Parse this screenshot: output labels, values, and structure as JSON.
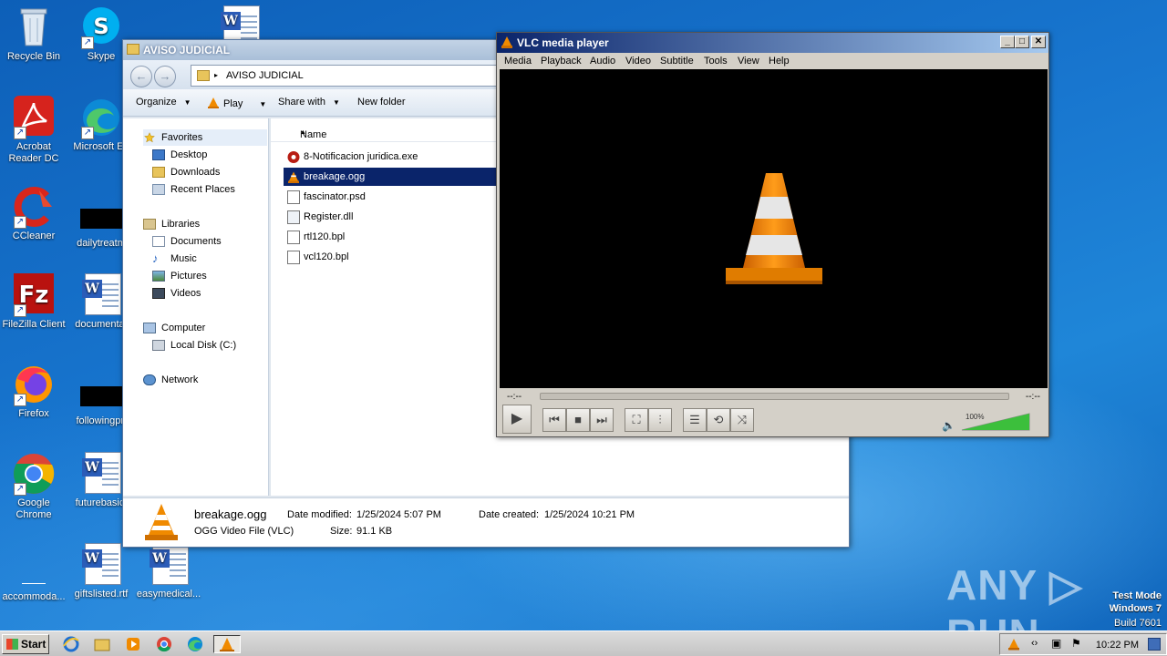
{
  "desktop": {
    "icons": [
      {
        "label": "Recycle Bin"
      },
      {
        "label": "Skype"
      },
      {
        "label": "Acrobat Reader DC"
      },
      {
        "label": "Microsoft Ed"
      },
      {
        "label": "CCleaner"
      },
      {
        "label": "dailytreatm"
      },
      {
        "label": "FileZilla Client"
      },
      {
        "label": "documentat"
      },
      {
        "label": "Firefox"
      },
      {
        "label": "followingpri"
      },
      {
        "label": "Google Chrome"
      },
      {
        "label": "futurebasic."
      },
      {
        "label": "accommoda..."
      },
      {
        "label": "giftslisted.rtf"
      },
      {
        "label": "easymedical..."
      }
    ],
    "watermark": "ANY ▷ RUN",
    "test_mode": [
      "Test Mode",
      "Windows 7",
      "Build 7601"
    ]
  },
  "explorer": {
    "title": "AVISO JUDICIAL",
    "address": "AVISO JUDICIAL",
    "toolbar": {
      "organize": "Organize",
      "play": "Play",
      "share_with": "Share with",
      "new_folder": "New folder"
    },
    "nav": {
      "favorites": "Favorites",
      "desktop": "Desktop",
      "downloads": "Downloads",
      "recent_places": "Recent Places",
      "libraries": "Libraries",
      "documents": "Documents",
      "music": "Music",
      "pictures": "Pictures",
      "videos": "Videos",
      "computer": "Computer",
      "local_disk": "Local Disk (C:)",
      "network": "Network"
    },
    "column_name": "Name",
    "files": [
      {
        "name": "8-Notificacion juridica.exe"
      },
      {
        "name": "breakage.ogg"
      },
      {
        "name": "fascinator.psd"
      },
      {
        "name": "Register.dll"
      },
      {
        "name": "rtl120.bpl"
      },
      {
        "name": "vcl120.bpl"
      }
    ],
    "details": {
      "file_name": "breakage.ogg",
      "file_type": "OGG Video File (VLC)",
      "date_modified_label": "Date modified:",
      "date_modified": "1/25/2024 5:07 PM",
      "size_label": "Size:",
      "size": "91.1 KB",
      "date_created_label": "Date created:",
      "date_created": "1/25/2024 10:21 PM"
    }
  },
  "vlc": {
    "title": "VLC media player",
    "menu": [
      "Media",
      "Playback",
      "Audio",
      "Video",
      "Subtitle",
      "Tools",
      "View",
      "Help"
    ],
    "time_elapsed": "--:--",
    "time_total": "--:--",
    "volume": "100%",
    "volume_level": 1.0
  },
  "taskbar": {
    "start": "Start",
    "clock": "10:22 PM"
  }
}
